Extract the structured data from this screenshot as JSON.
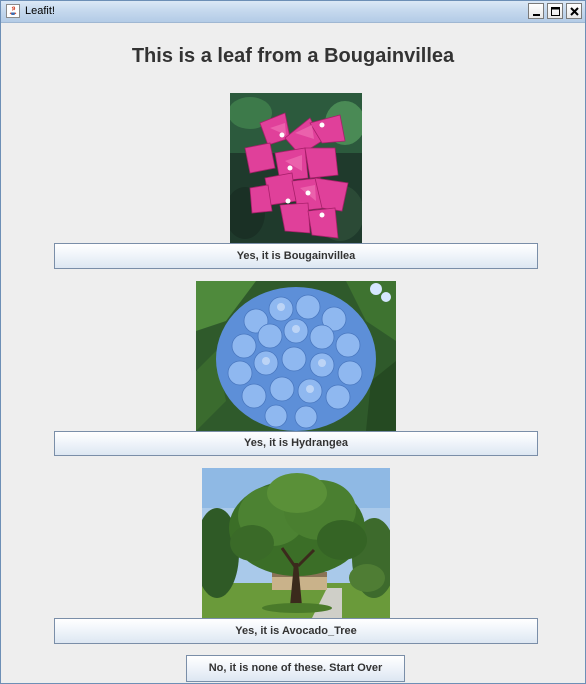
{
  "window": {
    "title": "Leafit!",
    "controls": [
      "minimize-icon",
      "maximize-icon",
      "close-icon"
    ]
  },
  "heading": "This is a leaf from a Bougainvillea",
  "options": [
    {
      "image": "bougainvillea-photo",
      "button_label": "Yes, it is Bougainvillea"
    },
    {
      "image": "hydrangea-photo",
      "button_label": "Yes, it is Hydrangea"
    },
    {
      "image": "avocado-tree-photo",
      "button_label": "Yes, it is Avocado_Tree"
    }
  ],
  "none_button_label": "No, it is none of these. Start Over"
}
